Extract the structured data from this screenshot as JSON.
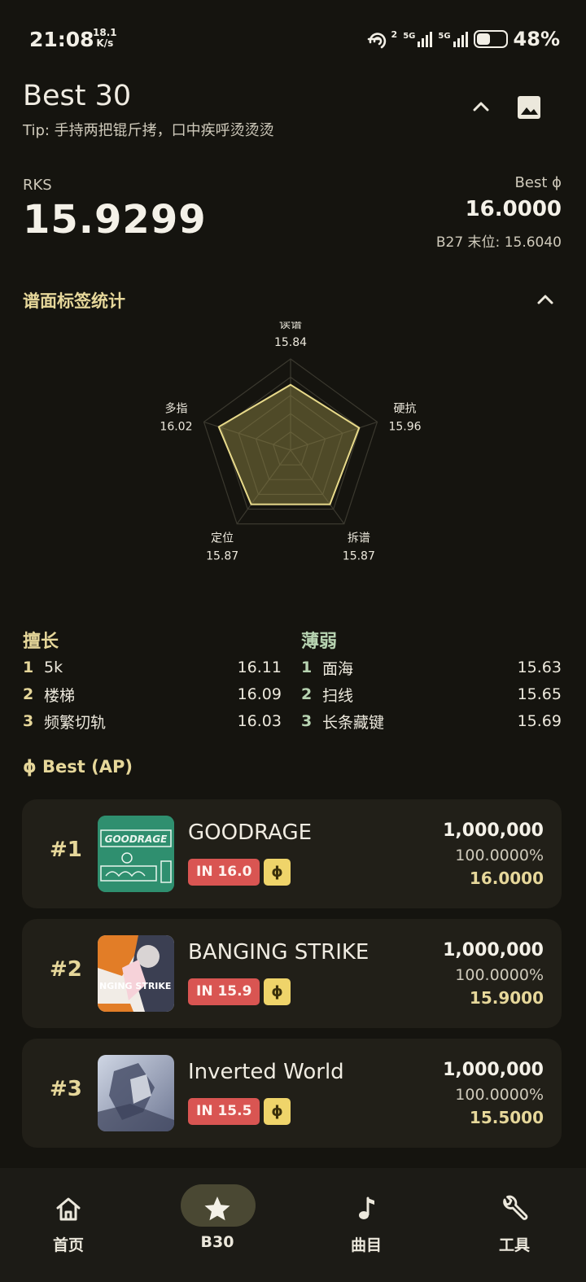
{
  "status_bar": {
    "time": "21:08",
    "speed_value": "18.1",
    "speed_unit": "K/s",
    "hotspot_count": "2",
    "sim1": "5G",
    "sim2": "5G",
    "battery": "48%",
    "battery_level": 0.48
  },
  "header": {
    "title": "Best 30",
    "tip": "Tip: 手持两把锟斤拷，口中疾呼烫烫烫"
  },
  "stats": {
    "rks_label": "RKS",
    "rks_value": "15.9299",
    "best_phi_label": "Best ϕ",
    "best_phi_value": "16.0000",
    "b27_line": "B27 末位: 15.6040"
  },
  "tag_section": {
    "title": "谱面标签统计",
    "radar": [
      {
        "label": "读谱",
        "value": "15.84"
      },
      {
        "label": "硬抗",
        "value": "15.96"
      },
      {
        "label": "拆谱",
        "value": "15.87"
      },
      {
        "label": "定位",
        "value": "15.87"
      },
      {
        "label": "多指",
        "value": "16.02"
      }
    ]
  },
  "strengths": {
    "title": "擅长",
    "items": [
      {
        "rank": "1",
        "name": "5k",
        "value": "16.11"
      },
      {
        "rank": "2",
        "name": "楼梯",
        "value": "16.09"
      },
      {
        "rank": "3",
        "name": "频繁切轨",
        "value": "16.03"
      }
    ]
  },
  "weaknesses": {
    "title": "薄弱",
    "items": [
      {
        "rank": "1",
        "name": "面海",
        "value": "15.63"
      },
      {
        "rank": "2",
        "name": "扫线",
        "value": "15.65"
      },
      {
        "rank": "3",
        "name": "长条藏键",
        "value": "15.69"
      }
    ]
  },
  "ap_section": {
    "title": "ϕ Best (AP)",
    "cards": [
      {
        "rank": "#1",
        "song": "GOODRAGE",
        "jacket_text": "GOODRAGE",
        "difficulty": "IN 16.0",
        "phi": "ϕ",
        "score": "1,000,000",
        "accuracy": "100.0000%",
        "rks": "16.0000"
      },
      {
        "rank": "#2",
        "song": "BANGING STRIKE",
        "jacket_text": "NGING STRIKE",
        "difficulty": "IN 15.9",
        "phi": "ϕ",
        "score": "1,000,000",
        "accuracy": "100.0000%",
        "rks": "15.9000"
      },
      {
        "rank": "#3",
        "song": "Inverted World",
        "jacket_text": "",
        "difficulty": "IN 15.5",
        "phi": "ϕ",
        "score": "1,000,000",
        "accuracy": "100.0000%",
        "rks": "15.5000"
      }
    ]
  },
  "bottom_nav": {
    "items": [
      {
        "label": "首页",
        "icon": "home-icon"
      },
      {
        "label": "B30",
        "icon": "star-icon",
        "active": true
      },
      {
        "label": "曲目",
        "icon": "music-note-icon"
      },
      {
        "label": "工具",
        "icon": "wrench-icon"
      }
    ]
  }
}
